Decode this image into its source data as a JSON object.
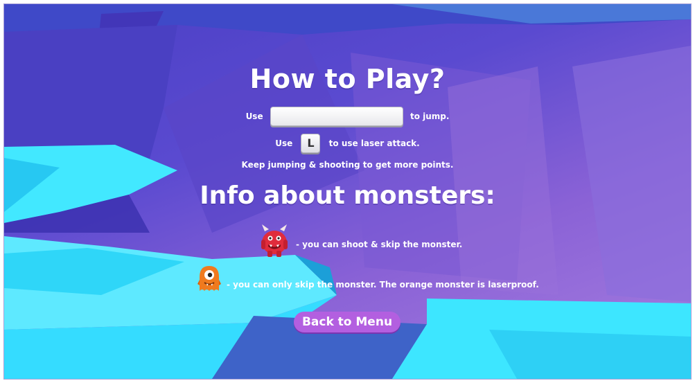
{
  "title": "How to Play?",
  "instructions": {
    "jump_prefix": "Use",
    "jump_suffix": "to jump.",
    "jump_key": "space-bar-key",
    "laser_prefix": "Use",
    "laser_key": "L",
    "laser_suffix": "to use laser attack.",
    "tip": "Keep jumping & shooting to get more points."
  },
  "monsters_heading": "Info about monsters:",
  "monsters": [
    {
      "icon": "red-horned-monster-icon",
      "description": "- you can shoot & skip the monster."
    },
    {
      "icon": "orange-one-eyed-monster-icon",
      "description": "- you can only skip the monster. The orange monster is laserproof."
    }
  ],
  "back_button_label": "Back to Menu",
  "colors": {
    "background_purple": "#5a4ad0",
    "ice_cyan": "#3fe6ff",
    "button_purple": "#b35fe0",
    "red_monster": "#e02c3c",
    "orange_monster": "#f07a1e"
  }
}
